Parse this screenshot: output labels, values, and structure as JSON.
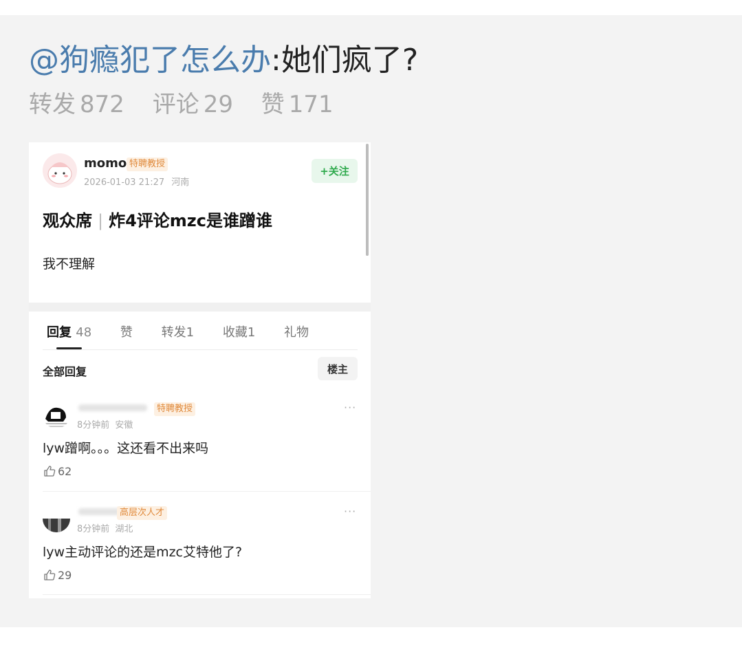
{
  "repost": {
    "mention": "@狗瘾犯了怎么办",
    "text": ":她们疯了?",
    "stats": {
      "forward_label": "转发",
      "forward_count": "872",
      "comment_label": "评论",
      "comment_count": "29",
      "like_label": "赞",
      "like_count": "171"
    }
  },
  "post": {
    "username": "momo",
    "badge": "特聘教授",
    "timestamp": "2026-01-03 21:27",
    "location": "河南",
    "follow_label": "+关注",
    "title_left": "观众席",
    "title_right": "炸4评论mzc是谁蹭谁",
    "body": "我不理解"
  },
  "tabs": [
    {
      "label": "回复",
      "count": "48"
    },
    {
      "label": "赞",
      "count": ""
    },
    {
      "label": "转发",
      "count": "1"
    },
    {
      "label": "收藏",
      "count": "1"
    },
    {
      "label": "礼物",
      "count": ""
    }
  ],
  "replies_header": {
    "all_replies_label": "全部回复",
    "op_label": "楼主"
  },
  "comments": [
    {
      "badge": "特聘教授",
      "time": "8分钟前",
      "location": "安徽",
      "text": "lyw蹭啊。。。这还看不出来吗",
      "likes": "62",
      "more": "···"
    },
    {
      "badge": "高层次人才",
      "time": "8分钟前",
      "location": "湖北",
      "text": "lyw主动评论的还是mzc艾特他了?",
      "likes": "29",
      "more": "···"
    }
  ],
  "colors": {
    "mention": "#4a7cad",
    "follow_green": "#2faa4d",
    "badge_orange": "#e08a3c"
  }
}
